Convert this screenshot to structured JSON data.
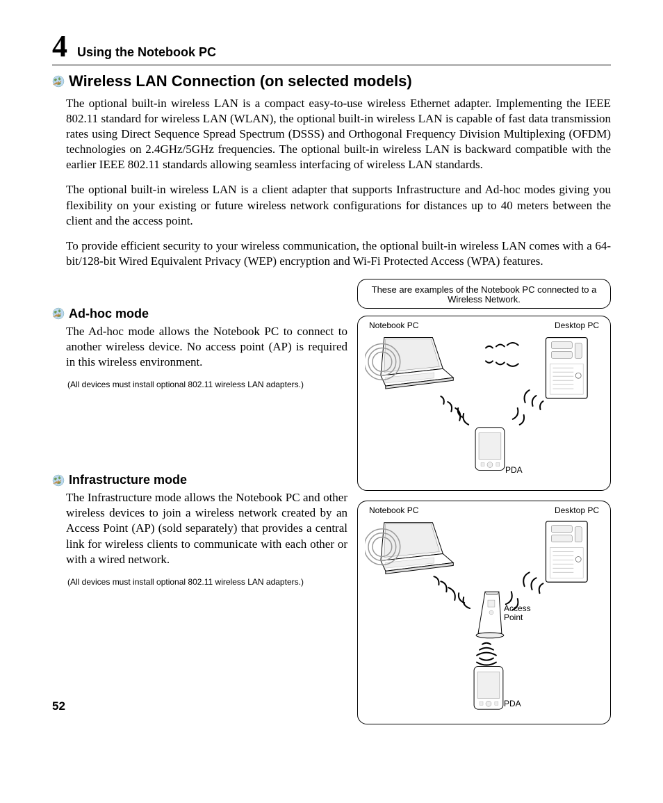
{
  "chapter": {
    "number": "4",
    "title": "Using the Notebook PC"
  },
  "h1": "Wireless LAN Connection (on selected models)",
  "p1": "The optional built-in wireless LAN is a compact easy-to-use wireless Ethernet adapter. Implementing the IEEE 802.11 standard for wireless LAN (WLAN), the optional built-in wireless LAN is capable of fast data transmission rates using Direct Sequence Spread Spectrum (DSSS) and Orthogonal Frequency Division Multiplexing (OFDM) technologies on 2.4GHz/5GHz frequencies. The optional built-in wireless LAN is backward compatible with the earlier IEEE 802.11 standards allowing seamless interfacing of wireless LAN standards.",
  "p2": "The optional built-in wireless LAN is a client adapter that supports Infrastructure and Ad-hoc modes giving you flexibility on your existing or future wireless network configurations for distances up to 40 meters between the client and the access point.",
  "p3": "To provide efficient security to your wireless communication, the optional built-in wireless LAN comes with a 64-bit/128-bit Wired Equivalent Privacy (WEP) encryption and Wi-Fi Protected Access (WPA) features.",
  "caption": "These are examples of the Notebook PC connected to a Wireless Network.",
  "adhoc": {
    "title": "Ad-hoc mode",
    "body": "The Ad-hoc mode allows the Notebook PC to connect to another wireless device. No access point (AP) is required in this wireless environment.",
    "note": "(All devices must install optional 802.11 wireless LAN adapters.)"
  },
  "infra": {
    "title": "Infrastructure mode",
    "body": "The Infrastructure mode allows the Notebook PC and other wireless devices to join a wireless network created by an Access Point (AP) (sold separately) that provides a central link for wireless clients to communicate with each other or with a wired network.",
    "note": "(All devices must install optional 802.11 wireless LAN adapters.)"
  },
  "labels": {
    "notebook": "Notebook PC",
    "desktop": "Desktop PC",
    "pda": "PDA",
    "ap": "Access Point"
  },
  "page_number": "52"
}
